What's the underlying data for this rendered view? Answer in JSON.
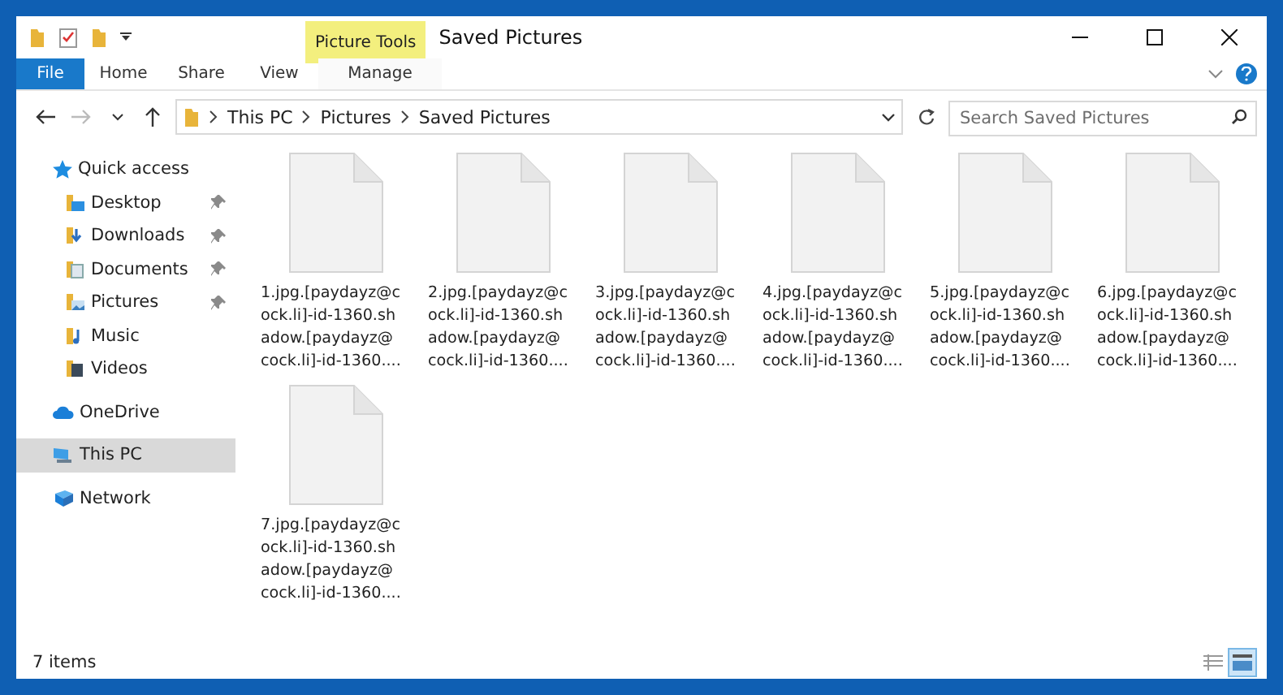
{
  "window": {
    "title": "Saved Pictures",
    "context_tab": "Picture Tools"
  },
  "ribbon_tabs": [
    {
      "label": "File",
      "kind": "file",
      "selected": false
    },
    {
      "label": "Home",
      "kind": "tab",
      "selected": false
    },
    {
      "label": "Share",
      "kind": "tab",
      "selected": false
    },
    {
      "label": "View",
      "kind": "tab",
      "selected": false
    },
    {
      "label": "Manage",
      "kind": "context",
      "selected": false
    }
  ],
  "address": {
    "path": [
      "This PC",
      "Pictures",
      "Saved Pictures"
    ]
  },
  "search": {
    "placeholder": "Search Saved Pictures"
  },
  "sidebar": {
    "items": [
      {
        "label": "Quick access",
        "selected": false,
        "children": [
          {
            "label": "Desktop",
            "pinned": true
          },
          {
            "label": "Downloads",
            "pinned": true
          },
          {
            "label": "Documents",
            "pinned": true
          },
          {
            "label": "Pictures",
            "pinned": true
          },
          {
            "label": "Music",
            "pinned": false
          },
          {
            "label": "Videos",
            "pinned": false
          }
        ]
      },
      {
        "label": "OneDrive",
        "selected": false
      },
      {
        "label": "This PC",
        "selected": true
      },
      {
        "label": "Network",
        "selected": false
      }
    ]
  },
  "files": [
    {
      "label_lines": [
        "1.jpg.[paydayz@c",
        "ock.li]-id-1360.sh",
        "adow.[paydayz@",
        "cock.li]-id-1360...."
      ]
    },
    {
      "label_lines": [
        "2.jpg.[paydayz@c",
        "ock.li]-id-1360.sh",
        "adow.[paydayz@",
        "cock.li]-id-1360...."
      ]
    },
    {
      "label_lines": [
        "3.jpg.[paydayz@c",
        "ock.li]-id-1360.sh",
        "adow.[paydayz@",
        "cock.li]-id-1360...."
      ]
    },
    {
      "label_lines": [
        "4.jpg.[paydayz@c",
        "ock.li]-id-1360.sh",
        "adow.[paydayz@",
        "cock.li]-id-1360...."
      ]
    },
    {
      "label_lines": [
        "5.jpg.[paydayz@c",
        "ock.li]-id-1360.sh",
        "adow.[paydayz@",
        "cock.li]-id-1360...."
      ]
    },
    {
      "label_lines": [
        "6.jpg.[paydayz@c",
        "ock.li]-id-1360.sh",
        "adow.[paydayz@",
        "cock.li]-id-1360...."
      ]
    },
    {
      "label_lines": [
        "7.jpg.[paydayz@c",
        "ock.li]-id-1360.sh",
        "adow.[paydayz@",
        "cock.li]-id-1360...."
      ]
    }
  ],
  "status_bar": {
    "count": "7 items",
    "view_buttons": [
      {
        "selected": false
      },
      {
        "selected": true
      }
    ]
  }
}
